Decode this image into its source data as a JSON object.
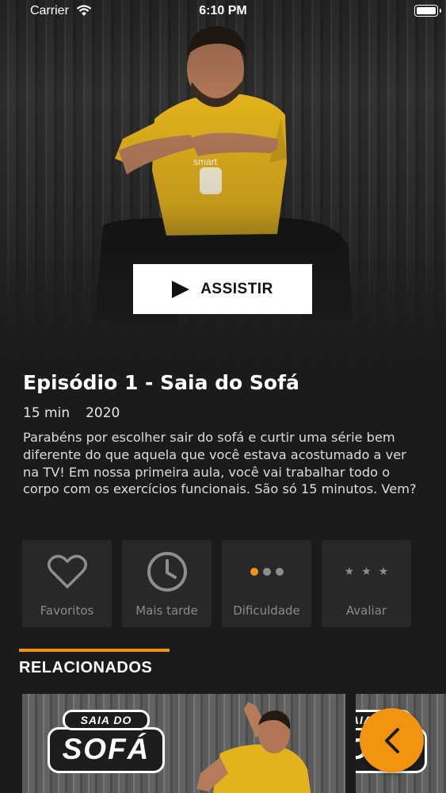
{
  "status_bar": {
    "carrier": "Carrier",
    "time": "6:10 PM"
  },
  "hero": {
    "watch_label": "ASSISTIR",
    "shirt_text": "smart"
  },
  "episode": {
    "title": "Episódio 1 - Saia do Sofá",
    "duration": "15 min",
    "year": "2020",
    "description": "Parabéns por escolher sair do sofá e curtir uma série bem diferente do que aquela que você estava acostumado a ver na TV! Em nossa primeira aula, você vai trabalhar todo o corpo com os exercícios funcionais. São só 15 minutos. Vem?"
  },
  "actions": [
    {
      "label": "Favoritos",
      "icon": "heart-icon"
    },
    {
      "label": "Mais tarde",
      "icon": "clock-icon"
    },
    {
      "label": "Dificuldade",
      "icon": "difficulty-dots-icon",
      "level": 1,
      "max": 3
    },
    {
      "label": "Avaliar",
      "icon": "stars-icon",
      "rating": 0,
      "max": 3
    }
  ],
  "related": {
    "title": "RELACIONADOS",
    "cards": [
      {
        "logo_top": "SAIA DO",
        "logo_main": "SOFÁ"
      },
      {
        "logo_top": "SAIA DO",
        "logo_main": "SOFÁ"
      }
    ]
  },
  "colors": {
    "accent": "#f39410",
    "background": "#1b1b1b",
    "tile": "#282828",
    "muted_text": "#8b8b8b"
  }
}
